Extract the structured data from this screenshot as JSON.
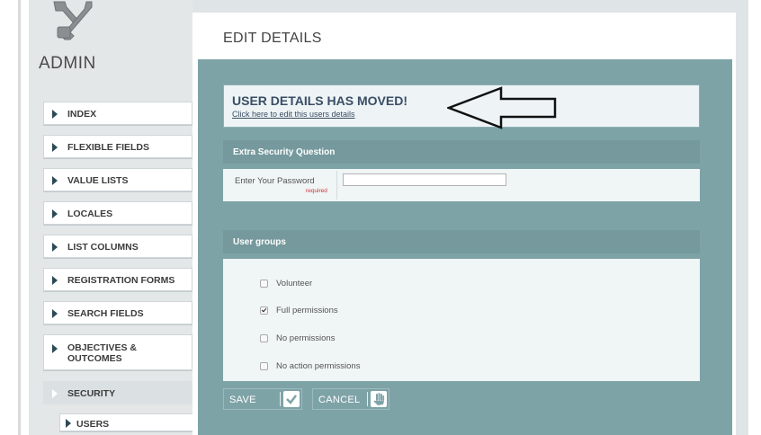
{
  "sidebar": {
    "title": "ADMIN",
    "items": [
      {
        "label": "INDEX"
      },
      {
        "label": "FLEXIBLE FIELDS"
      },
      {
        "label": "VALUE LISTS"
      },
      {
        "label": "LOCALES"
      },
      {
        "label": "LIST COLUMNS"
      },
      {
        "label": "REGISTRATION FORMS"
      },
      {
        "label": "SEARCH FIELDS"
      },
      {
        "label": "OBJECTIVES & OUTCOMES"
      },
      {
        "label": "SECURITY"
      },
      {
        "label": "USERS"
      }
    ]
  },
  "main": {
    "title": "EDIT DETAILS",
    "notice": {
      "title": "USER DETAILS HAS MOVED!",
      "link": "Click here to edit this users details"
    },
    "security": {
      "heading": "Extra Security Question",
      "password_label": "Enter Your Password",
      "required_label": "required",
      "password_value": ""
    },
    "groups": {
      "heading": "User groups",
      "options": [
        {
          "label": "Volunteer",
          "checked": false
        },
        {
          "label": "Full permissions",
          "checked": true
        },
        {
          "label": "No permissions",
          "checked": false
        },
        {
          "label": "No action permissions",
          "checked": false
        }
      ]
    },
    "buttons": {
      "save": "SAVE",
      "cancel": "CANCEL"
    }
  },
  "icons": {
    "logo": "tools-icon",
    "save": "checkmark-icon",
    "cancel": "hand-stop-icon",
    "annotation": "arrow-left-icon"
  },
  "colors": {
    "header": "#75999d",
    "content_bg": "#7ea3a7",
    "notice_text": "#3a4d66",
    "required": "#d43030"
  }
}
